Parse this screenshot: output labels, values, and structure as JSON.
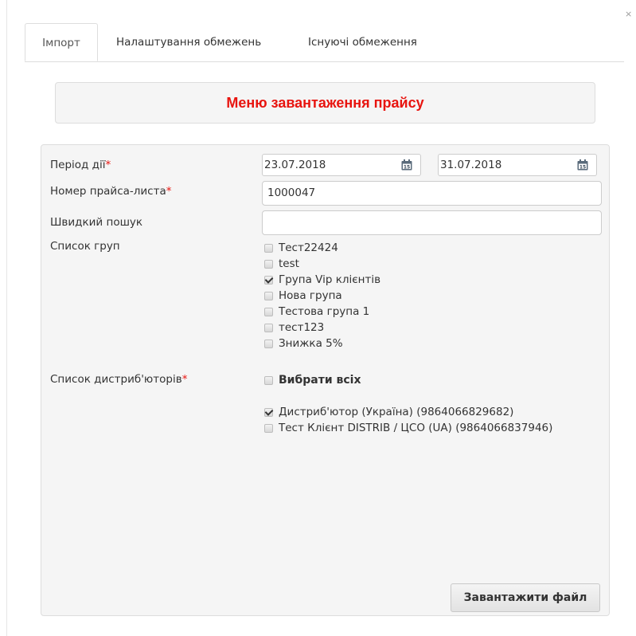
{
  "dialog": {
    "close_glyph": "×"
  },
  "tabs": [
    {
      "label": "Імпорт",
      "active": true
    },
    {
      "label": "Налаштування обмежень",
      "active": false
    },
    {
      "label": "Існуючі обмеження",
      "active": false
    }
  ],
  "header": {
    "title": "Меню завантаження прайсу",
    "color": "#e8140f"
  },
  "form": {
    "period": {
      "label": "Період дії",
      "required_mark": "*",
      "from": "23.07.2018",
      "to": "31.07.2018",
      "icon": "calendar-icon"
    },
    "price_list_number": {
      "label": "Номер прайса-листа",
      "required_mark": "*",
      "value": "1000047"
    },
    "quick_search": {
      "label": "Швидкий пошук",
      "value": ""
    },
    "groups": {
      "label": "Список груп",
      "items": [
        {
          "label": "Тест22424",
          "checked": false
        },
        {
          "label": "test",
          "checked": false
        },
        {
          "label": "Група Vip клієнтів",
          "checked": true
        },
        {
          "label": "Нова група",
          "checked": false
        },
        {
          "label": "Тестова група 1",
          "checked": false
        },
        {
          "label": "тест123",
          "checked": false
        },
        {
          "label": "Знижка 5%",
          "checked": false
        }
      ]
    },
    "distributors": {
      "label": "Список дистриб'юторів",
      "required_mark": "*",
      "select_all": {
        "label": "Вибрати всіх",
        "checked": false
      },
      "items": [
        {
          "label": "Дистриб'ютор (Україна) (9864066829682)",
          "checked": true
        },
        {
          "label": "Тест Клієнт DISTRIB / ЦСО (UA) (9864066837946)",
          "checked": false
        }
      ]
    },
    "upload_button": {
      "label": "Завантажити файл"
    }
  }
}
